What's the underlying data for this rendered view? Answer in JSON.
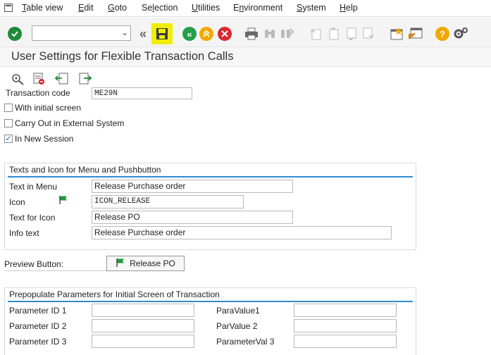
{
  "menu": {
    "items": [
      {
        "pre": "",
        "u": "T",
        "post": "able view"
      },
      {
        "pre": "",
        "u": "E",
        "post": "dit"
      },
      {
        "pre": "",
        "u": "G",
        "post": "oto"
      },
      {
        "pre": "Se",
        "u": "l",
        "post": "ection"
      },
      {
        "pre": "",
        "u": "U",
        "post": "tilities"
      },
      {
        "pre": "E",
        "u": "n",
        "post": "vironment"
      },
      {
        "pre": "",
        "u": "S",
        "post": "ystem"
      },
      {
        "pre": "",
        "u": "H",
        "post": "elp"
      }
    ]
  },
  "toolbar": {
    "command_field_value": "",
    "icons": [
      "enter-icon",
      "back-double-icon",
      "save-icon",
      "back-icon",
      "exit-icon",
      "cancel-icon",
      "print-icon",
      "find-icon",
      "find-next-icon",
      "first-page-icon",
      "previous-page-icon",
      "next-page-icon",
      "last-page-icon",
      "create-session-icon",
      "shortcut-icon",
      "help-icon",
      "settings-icon"
    ]
  },
  "page": {
    "title": "User Settings for Flexible Transaction Calls"
  },
  "form": {
    "transaction_code_label": "Transaction code",
    "transaction_code_value": "ME29N",
    "with_initial_screen_label": "With initial screen",
    "with_initial_screen_checked": false,
    "carry_out_external_label": "Carry Out in External System",
    "carry_out_external_checked": false,
    "in_new_session_label": "In New Session",
    "in_new_session_checked": true
  },
  "texts_group": {
    "title": "Texts and Icon for Menu and Pushbutton",
    "text_in_menu_label": "Text in Menu",
    "text_in_menu_value": "Release Purchase order",
    "icon_label": "Icon",
    "icon_value": "ICON_RELEASE",
    "text_for_icon_label": "Text for Icon",
    "text_for_icon_value": "Release PO",
    "info_text_label": "Info text",
    "info_text_value": "Release Purchase order"
  },
  "preview": {
    "label": "Preview Button:",
    "button_label": "Release PO"
  },
  "params_group": {
    "title": "Prepopulate Parameters for Initial Screen of Transaction",
    "param_id_1_label": "Parameter ID 1",
    "param_id_2_label": "Parameter ID 2",
    "param_id_3_label": "Parameter ID 3",
    "para_value_1_label": "ParaValue1",
    "par_value_2_label": "ParValue 2",
    "parameter_val_3_label": "ParameterVal 3",
    "param_id_1_value": "",
    "param_id_2_value": "",
    "param_id_3_value": "",
    "para_value_1_value": "",
    "par_value_2_value": "",
    "parameter_val_3_value": ""
  },
  "colors": {
    "accent_blue": "#2f8bd1",
    "enter_green": "#1f8a3a",
    "save_highlight": "#f0ee00",
    "cancel_red": "#d9282f",
    "nav_green": "#23a04a",
    "exit_orange": "#f2a800",
    "help_orange": "#f2a800",
    "flag_green": "#1f9a3a"
  }
}
